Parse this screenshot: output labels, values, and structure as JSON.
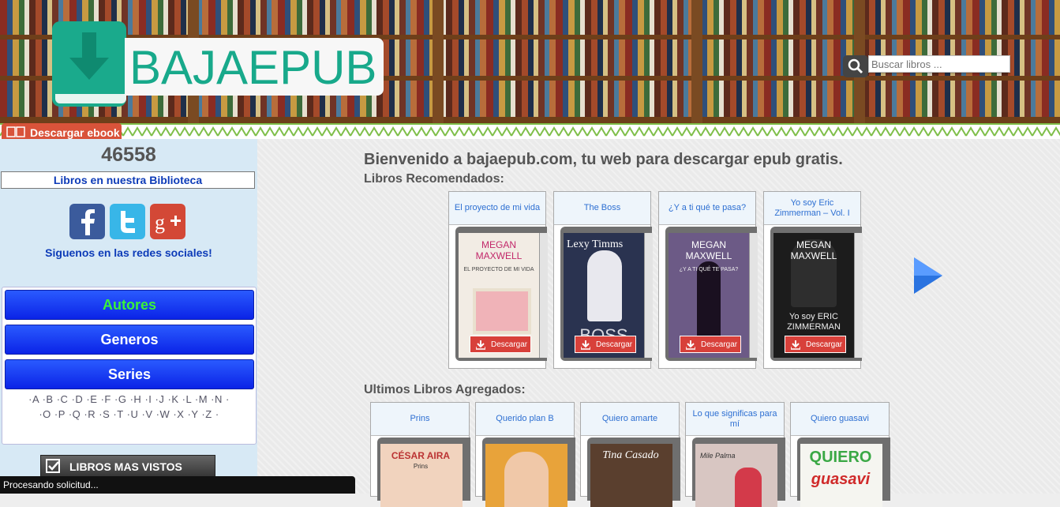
{
  "header": {
    "logo_text": "BAJAEPUB",
    "search_placeholder": "Buscar libros ..."
  },
  "nav": {
    "tab_label": "Descargar ebook"
  },
  "sidebar": {
    "book_count": "46558",
    "count_label": "Libros en nuestra Biblioteca",
    "social_text": "Siguenos en las redes sociales!",
    "menu": [
      "Autores",
      "Generos",
      "Series"
    ],
    "alphabet_row1": [
      "A",
      "B",
      "C",
      "D",
      "E",
      "F",
      "G",
      "H",
      "I",
      "J",
      "K",
      "L",
      "M",
      "N"
    ],
    "alphabet_row2": [
      "O",
      "P",
      "Q",
      "R",
      "S",
      "T",
      "U",
      "V",
      "W",
      "X",
      "Y",
      "Z"
    ],
    "mas_vistos": "LIBROS MAS VISTOS"
  },
  "main": {
    "welcome": "Bienvenido a bajaepub.com, tu web para descargar epub gratis.",
    "recommended_title": "Libros Recomendados:",
    "recommended": [
      {
        "title": "El proyecto de mi vida",
        "cover_author": "MEGAN MAXWELL",
        "cover_sub": "EL PROYECTO DE MI VIDA",
        "download": "Descargar",
        "color": "#f2ece4"
      },
      {
        "title": "The Boss",
        "cover_author": "Lexy Timms",
        "cover_sub": "BOSS",
        "download": "Descargar",
        "color": "#2a3350"
      },
      {
        "title": "¿Y a ti qué te pasa?",
        "cover_author": "MEGAN MAXWELL",
        "cover_sub": "¿Y A TI QUÉ TE PASA?",
        "download": "Descargar",
        "color": "#6c5a86"
      },
      {
        "title": "Yo soy Eric Zimmerman – Vol. I",
        "cover_author": "MEGAN MAXWELL",
        "cover_sub": "Yo soy ERIC ZIMMERMAN",
        "download": "Descargar",
        "color": "#1c1c1c"
      }
    ],
    "latest_title": "Ultimos Libros Agregados:",
    "latest": [
      {
        "title": "Prins",
        "cover_author": "CÉSAR AIRA",
        "cover_sub": "Prins",
        "color": "#f1d3be"
      },
      {
        "title": "Querido plan B",
        "cover_author": "",
        "cover_sub": "",
        "color": "#e8a33a"
      },
      {
        "title": "Quiero amarte",
        "cover_author": "Tina Casado",
        "cover_sub": "",
        "color": "#5a3f2e"
      },
      {
        "title": "Lo que significas para mí",
        "cover_author": "Mile Palma",
        "cover_sub": "",
        "color": "#d8c6c2"
      },
      {
        "title": "Quiero guasavi",
        "cover_author": "QUIERO",
        "cover_sub": "guasavi",
        "color": "#f5f5f0"
      }
    ]
  },
  "status": "Procesando solicitud...",
  "colors": {
    "brand": "#1aaa8c",
    "menu_blue": "#1a3cff",
    "link": "#2d6fd2",
    "download": "#d8403a"
  }
}
